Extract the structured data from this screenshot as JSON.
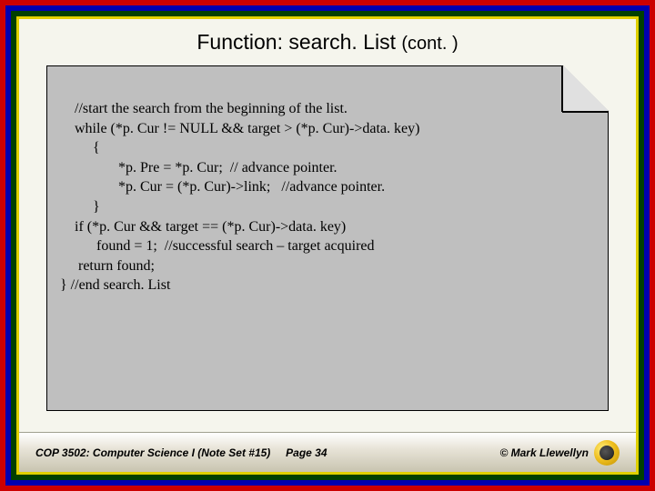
{
  "title": {
    "main": "Function: search. List",
    "cont": "(cont. )"
  },
  "code": {
    "l1": "    //start the search from the beginning of the list.",
    "l2": "    while (*p. Cur != NULL && target > (*p. Cur)->data. key)",
    "l3": "         {",
    "l4": "                *p. Pre = *p. Cur;  // advance pointer.",
    "l5": "                *p. Cur = (*p. Cur)->link;   //advance pointer.",
    "l6": "         }",
    "l7": "    if (*p. Cur && target == (*p. Cur)->data. key)",
    "l8": "          found = 1;  //successful search – target acquired",
    "l9": "",
    "l10": "     return found;",
    "l11": "} //end search. List"
  },
  "footer": {
    "left": "COP 3502: Computer Science I  (Note Set #15)",
    "center": "Page 34",
    "right": "© Mark Llewellyn"
  }
}
